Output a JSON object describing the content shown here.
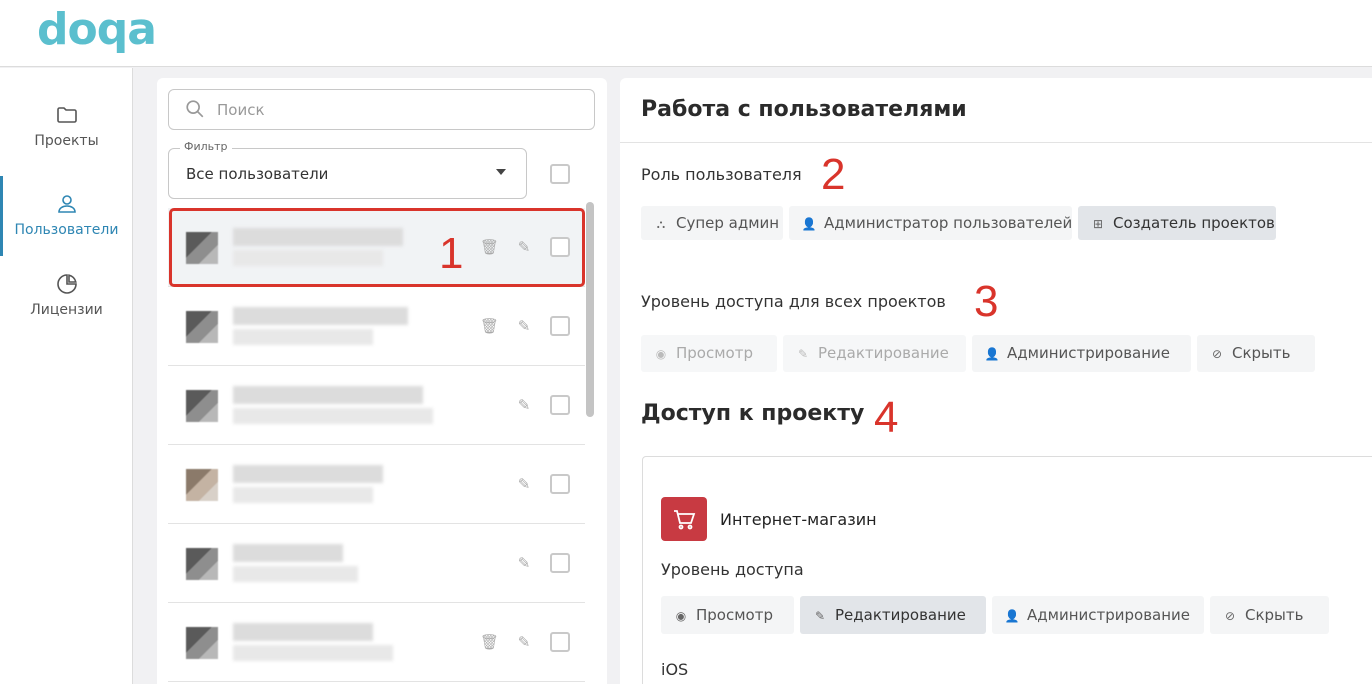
{
  "app": {
    "logo_text": "doqa",
    "brand_color": "#5bbfce",
    "accent_color": "#2e86b3"
  },
  "nav": {
    "items": [
      {
        "label": "Проекты",
        "icon": "folder-icon",
        "active": false
      },
      {
        "label": "Пользователи",
        "icon": "user-icon",
        "active": true
      },
      {
        "label": "Лицензии",
        "icon": "pie-chart-icon",
        "active": false
      }
    ]
  },
  "users_panel": {
    "search_placeholder": "Поиск",
    "filter": {
      "label": "Фильтр",
      "value": "Все пользователи"
    },
    "rows_note": "user names and emails are pixelated/blurred",
    "rows": [
      {
        "selected": true,
        "deletable": true
      },
      {
        "selected": false,
        "deletable": true
      },
      {
        "selected": false,
        "deletable": false
      },
      {
        "selected": false,
        "deletable": false
      },
      {
        "selected": false,
        "deletable": false
      },
      {
        "selected": false,
        "deletable": true
      }
    ]
  },
  "annotations": {
    "n1": "1",
    "n2": "2",
    "n3": "3",
    "n4": "4",
    "color": "#d9342b"
  },
  "main": {
    "title": "Работа с пользователями",
    "role_label": "Роль пользователя",
    "roles": [
      {
        "label": "Супер админ",
        "icon": "hierarchy-icon",
        "active": false
      },
      {
        "label": "Администратор пользователей",
        "icon": "user-icon",
        "active": false
      },
      {
        "label": "Создатель проектов",
        "icon": "grid-plus-icon",
        "active": true
      }
    ],
    "access_all_label": "Уровень доступа для всех проектов",
    "access_all": [
      {
        "label": "Просмотр",
        "icon": "eye-icon",
        "disabled": true
      },
      {
        "label": "Редактирование",
        "icon": "edit-icon",
        "disabled": true
      },
      {
        "label": "Администрирование",
        "icon": "user-icon",
        "disabled": false
      },
      {
        "label": "Скрыть",
        "icon": "eye-off-icon",
        "disabled": false
      }
    ],
    "project_access_title": "Доступ к проекту",
    "project": {
      "name": "Интернет-магазин",
      "icon": "cart-icon",
      "icon_color": "#c83a42",
      "access_label": "Уровень доступа",
      "levels": [
        {
          "label": "Просмотр",
          "icon": "eye-icon",
          "active": false
        },
        {
          "label": "Редактирование",
          "icon": "edit-icon",
          "active": true
        },
        {
          "label": "Администрирование",
          "icon": "user-icon",
          "active": false
        },
        {
          "label": "Скрыть",
          "icon": "eye-off-icon",
          "active": false
        }
      ],
      "next_section": "iOS"
    }
  }
}
